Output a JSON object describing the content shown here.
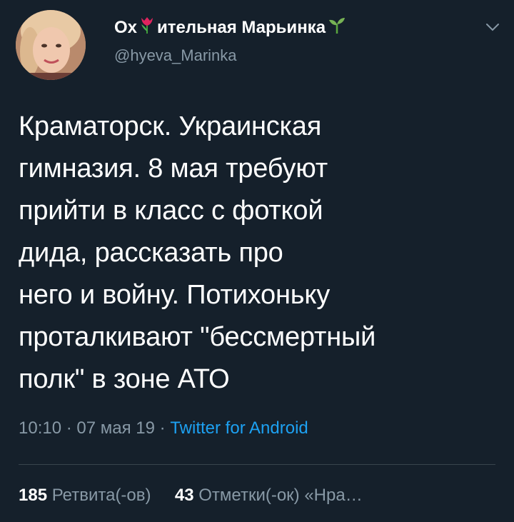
{
  "author": {
    "display_name_part1": "Ох",
    "display_name_part2": "ительная Марьинка",
    "handle": "@hyeva_Marinka",
    "icon_inline": "tulip-icon",
    "icon_trailing": "seedling-icon"
  },
  "tweet": {
    "text": "Краматорск. Украинская\nгимназия. 8 мая требуют\nприйти в класс с фоткой\nдида, рассказать про\nнего и войну. Потихоньку\nпроталкивают \"бессмертный\nполк\" в зоне АТО"
  },
  "meta": {
    "time": "10:10",
    "date": "07 мая 19",
    "separator": "·",
    "source": "Twitter for Android"
  },
  "stats": {
    "retweets_count": "185",
    "retweets_label": "Ретвита(-ов)",
    "likes_count": "43",
    "likes_label": "Отметки(-ок) «Нра…"
  },
  "colors": {
    "background": "#15202b",
    "secondary_text": "#8899a6",
    "link": "#1da1f2",
    "divider": "#38444d"
  }
}
